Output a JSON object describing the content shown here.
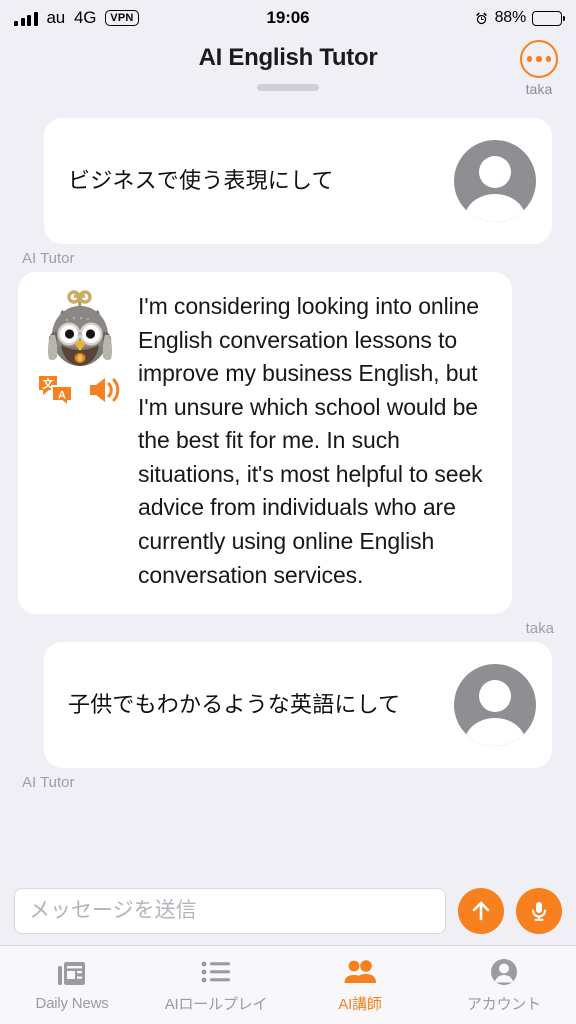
{
  "status_bar": {
    "carrier": "au",
    "network": "4G",
    "vpn": "VPN",
    "time": "19:06",
    "battery_percent": "88%",
    "battery_level": 88,
    "alarm_icon": "alarm-clock-icon",
    "signal_icon": "cellular-signal-icon",
    "battery_icon": "battery-icon"
  },
  "header": {
    "title": "AI English Tutor",
    "menu_icon": "more-options-icon",
    "menu_label": "taka",
    "drag_handle": "drag-handle"
  },
  "chat": {
    "messages": [
      {
        "sender": "user",
        "label": "taka",
        "label_position": "above-hidden",
        "text": "ビジネスで使う表現にして",
        "avatar_icon": "user-avatar-icon"
      },
      {
        "sender": "ai",
        "label": "AI Tutor",
        "text": "I'm considering looking into online English conversation lessons to improve my business English, but I'm unsure which school would be the best fit for me. In such situations, it's most helpful to seek advice from individuals who are currently using online English conversation services.",
        "avatar_icon": "robot-owl-avatar-icon",
        "actions": [
          {
            "icon": "translate-icon",
            "name": "translate"
          },
          {
            "icon": "speaker-icon",
            "name": "speak"
          }
        ]
      },
      {
        "sender": "user",
        "label": "taka",
        "text": "子供でもわかるような英語にして",
        "avatar_icon": "user-avatar-icon"
      }
    ],
    "labels": {
      "ai_tutor": "AI Tutor",
      "user": "taka"
    }
  },
  "input_bar": {
    "placeholder": "メッセージを送信",
    "value": "",
    "send_icon": "arrow-up-icon",
    "mic_icon": "microphone-icon"
  },
  "tab_bar": {
    "active_index": 2,
    "tabs": [
      {
        "label": "Daily News",
        "icon": "newspaper-icon",
        "active": false
      },
      {
        "label": "AIロールプレイ",
        "icon": "list-icon",
        "active": false
      },
      {
        "label": "AI講師",
        "icon": "people-icon",
        "active": true
      },
      {
        "label": "アカウント",
        "icon": "account-person-icon",
        "active": false
      }
    ]
  },
  "colors": {
    "accent": "#f7801f",
    "background": "#f0eff5",
    "bubble": "#ffffff",
    "muted_text": "#a0a0aa",
    "tabbar_background": "#f8f8fa",
    "avatar_gray": "#8e8e93"
  }
}
